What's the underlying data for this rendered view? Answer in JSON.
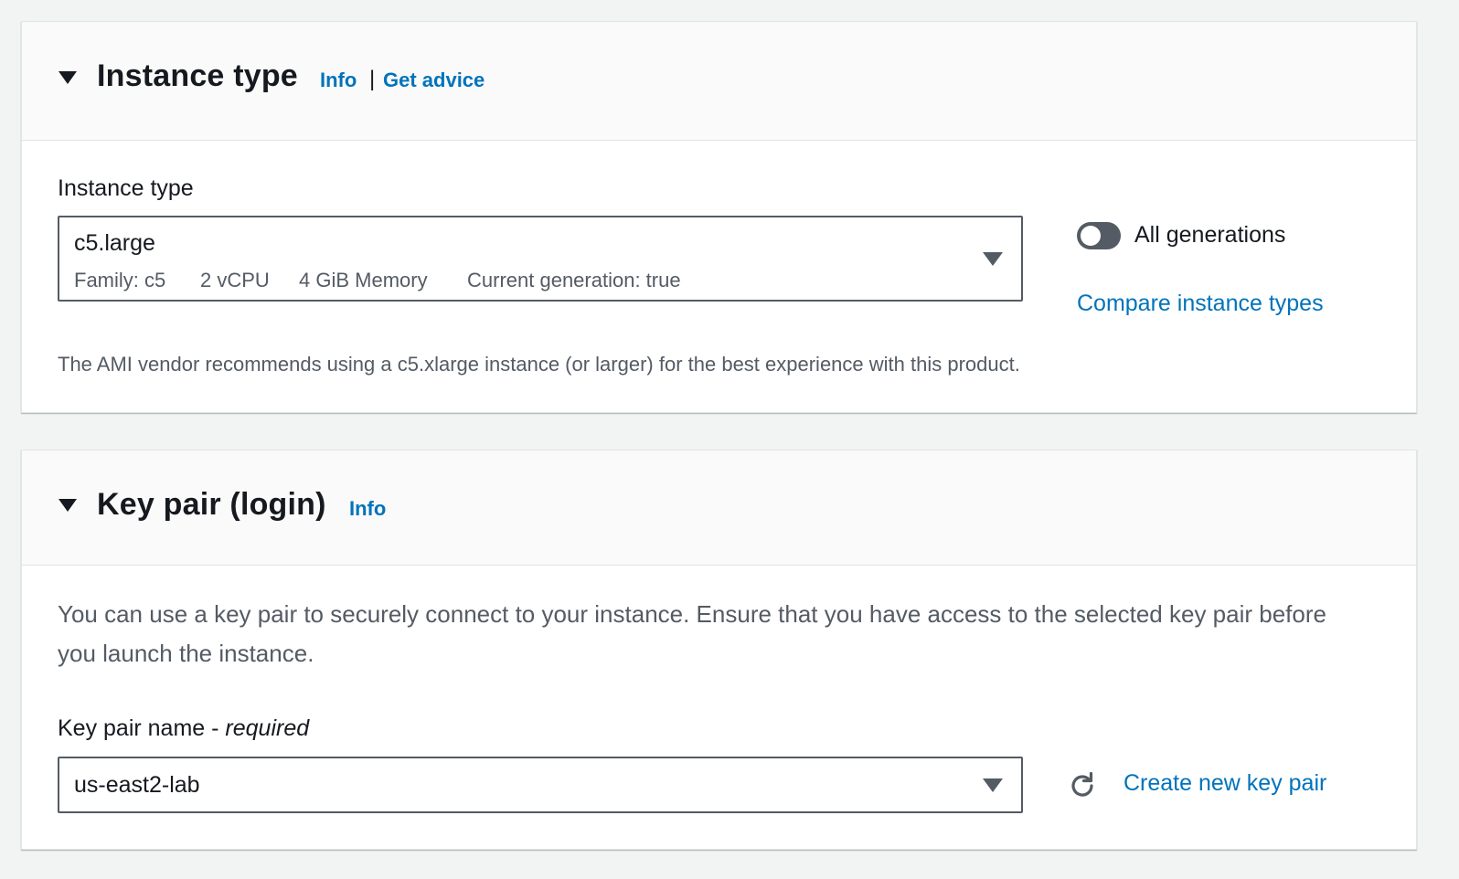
{
  "instance_panel": {
    "title": "Instance type",
    "info_link": "Info",
    "separator": "|",
    "advice_link": "Get advice",
    "field_label": "Instance type",
    "selected": {
      "value": "c5.large",
      "family": "Family: c5",
      "vcpu": "2 vCPU",
      "memory": "4 GiB Memory",
      "generation": "Current generation: true"
    },
    "toggle_label": "All generations",
    "toggle_on": false,
    "compare_link": "Compare instance types",
    "recommendation": "The AMI vendor recommends using a c5.xlarge instance (or larger) for the best experience with this product."
  },
  "keypair_panel": {
    "title": "Key pair (login)",
    "info_link": "Info",
    "description": "You can use a key pair to securely connect to your instance. Ensure that you have access to the selected key pair before you launch the instance.",
    "field_label": "Key pair name - ",
    "field_required": "required",
    "selected": "us-east2-lab",
    "refresh_icon": "refresh-icon",
    "create_link": "Create new key pair"
  },
  "colors": {
    "link": "#0073bb",
    "text": "#16191f",
    "secondary_text": "#545b64",
    "page_bg": "#f2f3f3",
    "header_bg": "#fafafa"
  }
}
